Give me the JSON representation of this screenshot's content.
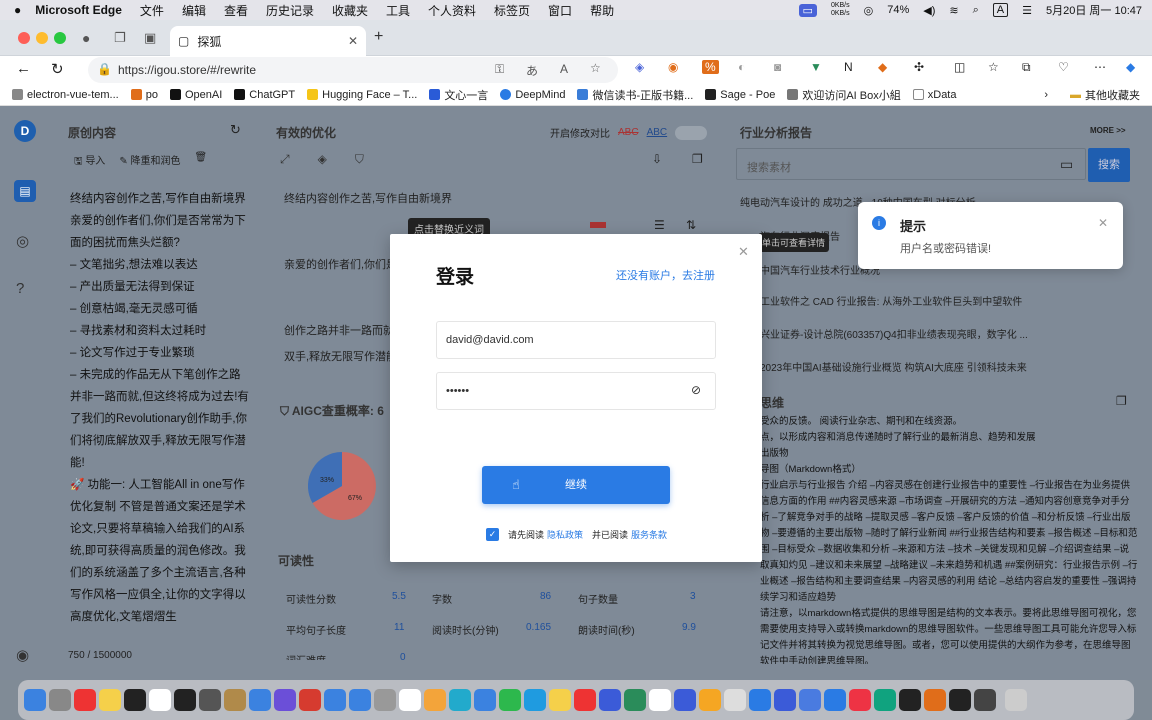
{
  "menubar": {
    "brand": "Microsoft Edge",
    "items": [
      "文件",
      "编辑",
      "查看",
      "历史记录",
      "收藏夹",
      "工具",
      "个人资料",
      "标签页",
      "窗口",
      "帮助"
    ],
    "net_up": "0KB/s",
    "net_down": "0KB/s",
    "battery": "74%",
    "ime": "A",
    "datetime": "5月20日 周一  10:47"
  },
  "browser": {
    "tab_title": "探狐",
    "url": "https://igou.store/#/rewrite",
    "bookmarks": [
      "electron-vue-tem...",
      "po",
      "OpenAI",
      "ChatGPT",
      "Hugging Face – T...",
      "文心一言",
      "DeepMind",
      "微信读书-正版书籍...",
      "Sage - Poe",
      "欢迎访问AI Box小組",
      "xData"
    ],
    "bookmarks_folder": "其他收藏夹"
  },
  "left_panel": {
    "title": "原创内容",
    "import": "导入",
    "reduce": "降重和润色",
    "text": "终结内容创作之苦,写作自由新境界\n亲爱的创作者们,你们是否常常为下面的困扰而焦头烂额?\n– 文笔拙劣,想法难以表达\n– 产出质量无法得到保证\n– 创意枯竭,毫无灵感可循\n– 寻找素材和资料太过耗时\n– 论文写作过于专业繁琐\n– 未完成的作品无从下笔创作之路并非一路而就,但这终将成为过去!有了我们的Revolutionary创作助手,你们将彻底解放双手,释放无限写作潜能!\n🚀 功能一: 人工智能All in one写作优化复制 不管是普通文案还是学术论文,只要将草稿输入给我们的AI系统,即可获得高质量的润色修改。我们的系统涵盖了多个主流语言,各种写作风格一应俱全,让你的文字得以高度优化,文笔熠熠生",
    "count": "750 / 1500000"
  },
  "middle_panel": {
    "title": "有效的优化",
    "toggle_label": "开启修改对比",
    "abc1": "ABC",
    "abc2": "ABC",
    "p1": "终结内容创作之苦,写作自由新境界",
    "tooltip": "点击替换近义词",
    "p2": "亲爱的创作者们,你们是否",
    "p3": "创作之路并非一路而就,",
    "p4": "双手,释放无限写作潜能!",
    "aigc_title": "AIGC查重概率: 6",
    "pie_a": "33%",
    "pie_b": "67%",
    "readability_title": "可读性",
    "stats": [
      {
        "label": "可读性分数",
        "value": "5.5"
      },
      {
        "label": "字数",
        "value": "86"
      },
      {
        "label": "句子数量",
        "value": "3"
      },
      {
        "label": "平均句子长度",
        "value": "11"
      },
      {
        "label": "阅读时长(分钟)",
        "value": "0.165"
      },
      {
        "label": "朗读时间(秒)",
        "value": "9.9"
      }
    ],
    "last_row_label": "词汇难度",
    "last_row_value": "0"
  },
  "right_panel": {
    "title": "行业分析报告",
    "more": "MORE >>",
    "search_placeholder": "搜索素材",
    "search_btn": "搜索",
    "reports": [
      "纯电动汽车设计的 成功之道 - 10种中国车型 对标分析",
      "汽车行业深度报告",
      "中国汽车行业技术行业概况",
      "工业软件之 CAD 行业报告: 从海外工业软件巨头到中望软件",
      "兴业证券-设计总院(603357)Q4扣非业绩表现亮眼，数字化 ...",
      "2023年中国AI基础设施行业概览 构筑AI大底座 引领科技未来"
    ],
    "hover_tip": "单击可查看详情",
    "mind_title": "思维",
    "mind_text": "受众的反馈。 阅读行业杂志、期刊和在线资源。\n点，以形成内容和消息传递随时了解行业的最新消息、趋势和发展\n出版物\n导图（Markdown格式）\n行业启示与行业报告 介绍 –内容灵感在创建行业报告中的重要性 –行业报告在为业务提供信息方面的作用 ##内容灵感来源 –市场调查 –开展研究的方法 –通知内容创意竞争对手分析 –了解竞争对手的战略 –提取灵感 –客户反馈 –客户反馈的价值 –和分析反馈 –行业出版物 –要遵循的主要出版物 –随时了解行业新闻 ##行业报告结构和要素 –报告概述 –目标和范围 –目标受众 –数据收集和分析 –来源和方法 –技术 –关键发现和见解 –介绍调查结果 –说取真知灼见 –建议和未来展望 –战略建议 –未来趋势和机遇 ##案例研究：行业报告示例 –行业概述 –报告结构和主要调查结果 –内容灵感的利用 结论 –总结内容启发的重要性 –强调持续学习和适应趋势\n请注意，以markdown格式提供的思维导图是结构的文本表示。要将此思维导图可视化，您需要使用支持导入或转换markdown的思维导图软件。一些思维导图工具可能允许您导入标记文件并将其转换为视觉思维导图。或者，您可以使用提供的大纲作为参考，在思维导图软件中手动创建思维导图。"
  },
  "login_modal": {
    "title": "登录",
    "register_link": "还没有账户，去注册",
    "email": "david@david.com",
    "password": "••••••",
    "continue": "继续",
    "agree_prefix": "请先阅读",
    "privacy": "隐私政策",
    "agree_mid": "并已阅读",
    "terms": "服务条款"
  },
  "toast": {
    "title": "提示",
    "message": "用户名或密码错误!"
  },
  "colors": {
    "accent": "#2a7be4",
    "pie_blue": "#3f6fb6",
    "pie_red": "#cc6b64"
  }
}
